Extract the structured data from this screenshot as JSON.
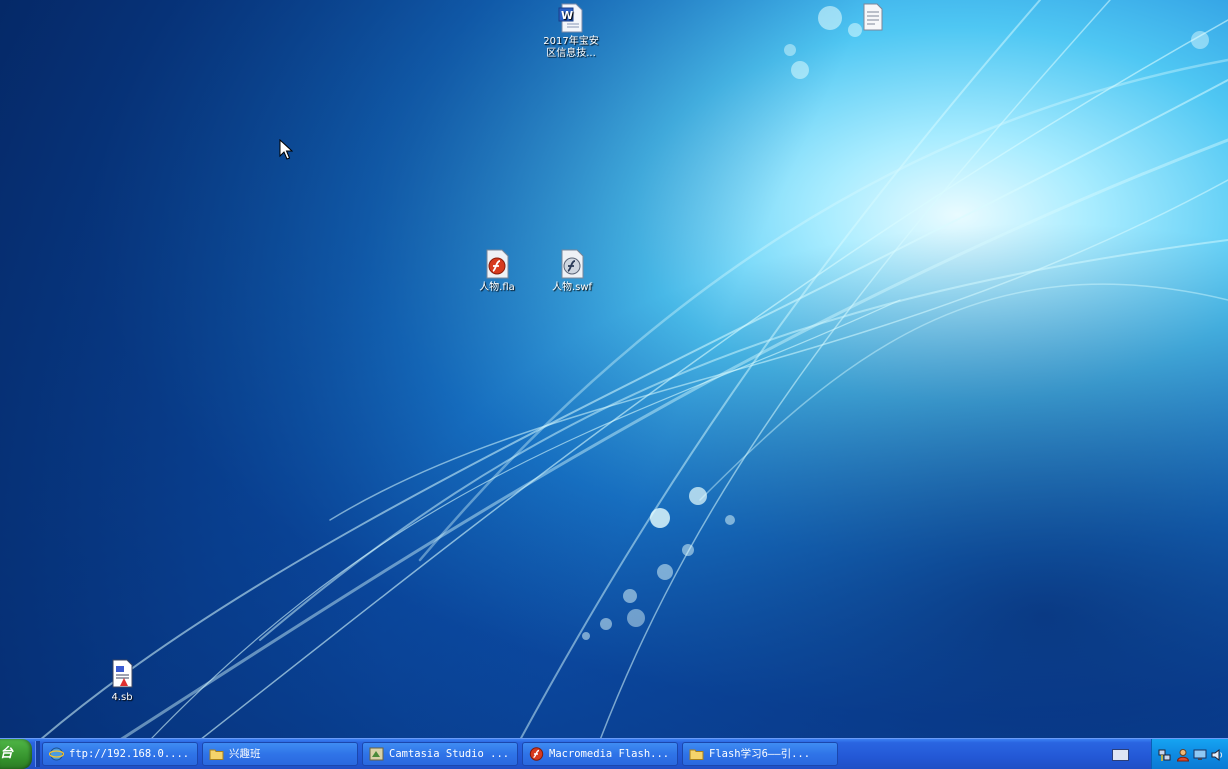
{
  "desktop": {
    "icons": [
      {
        "id": "word-doc",
        "label": "2017年宝安\n区信息技..."
      },
      {
        "id": "text-doc",
        "label": ""
      },
      {
        "id": "fla-file",
        "label": "人物.fla"
      },
      {
        "id": "swf-file",
        "label": "人物.swf"
      },
      {
        "id": "sb-file",
        "label": "4.sb"
      }
    ]
  },
  "taskbar": {
    "start_label": "台",
    "buttons": [
      {
        "label": "ftp://192.168.0....",
        "icon": "ie-globe-icon"
      },
      {
        "label": "兴趣班",
        "icon": "folder-icon"
      },
      {
        "label": "Camtasia Studio ...",
        "icon": "camtasia-icon"
      },
      {
        "label": "Macromedia Flash...",
        "icon": "flash-icon"
      },
      {
        "label": "Flash学习6——引...",
        "icon": "folder-icon"
      }
    ],
    "tray_icons": [
      "keyboard-icon",
      "network-icon",
      "user-icon",
      "monitor-icon",
      "volume-icon"
    ]
  },
  "colors": {
    "taskbar_blue": "#2358d6",
    "start_green": "#3a9b33",
    "tray_blue": "#0f8be3"
  }
}
